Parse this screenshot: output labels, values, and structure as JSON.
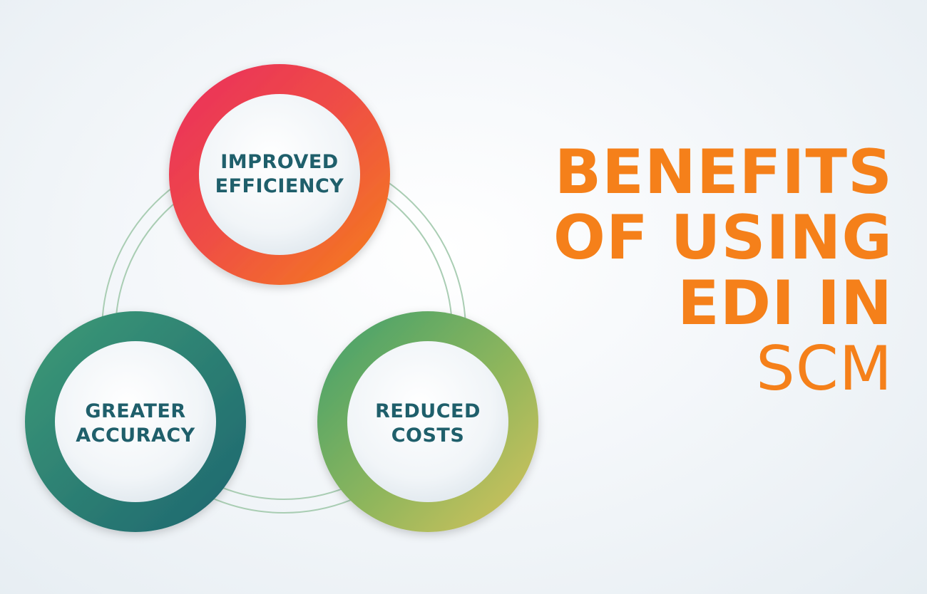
{
  "headline": {
    "line1": "BENEFITS",
    "line2": "OF USING",
    "line3": "EDI IN",
    "line4": "SCM"
  },
  "nodes": {
    "top": {
      "line1": "IMPROVED",
      "line2": "EFFICIENCY"
    },
    "left": {
      "line1": "GREATER",
      "line2": "ACCURACY"
    },
    "right": {
      "line1": "REDUCED",
      "line2": "COSTS"
    }
  },
  "colors": {
    "headline": "#f5801a",
    "label": "#1f5f6b",
    "top_ring": [
      "#ea2c5e",
      "#f5801a"
    ],
    "left_ring": [
      "#3d9b76",
      "#1f6a72"
    ],
    "right_ring": [
      "#3ea06a",
      "#d2c05a"
    ],
    "connector": "#8fbf9f"
  }
}
